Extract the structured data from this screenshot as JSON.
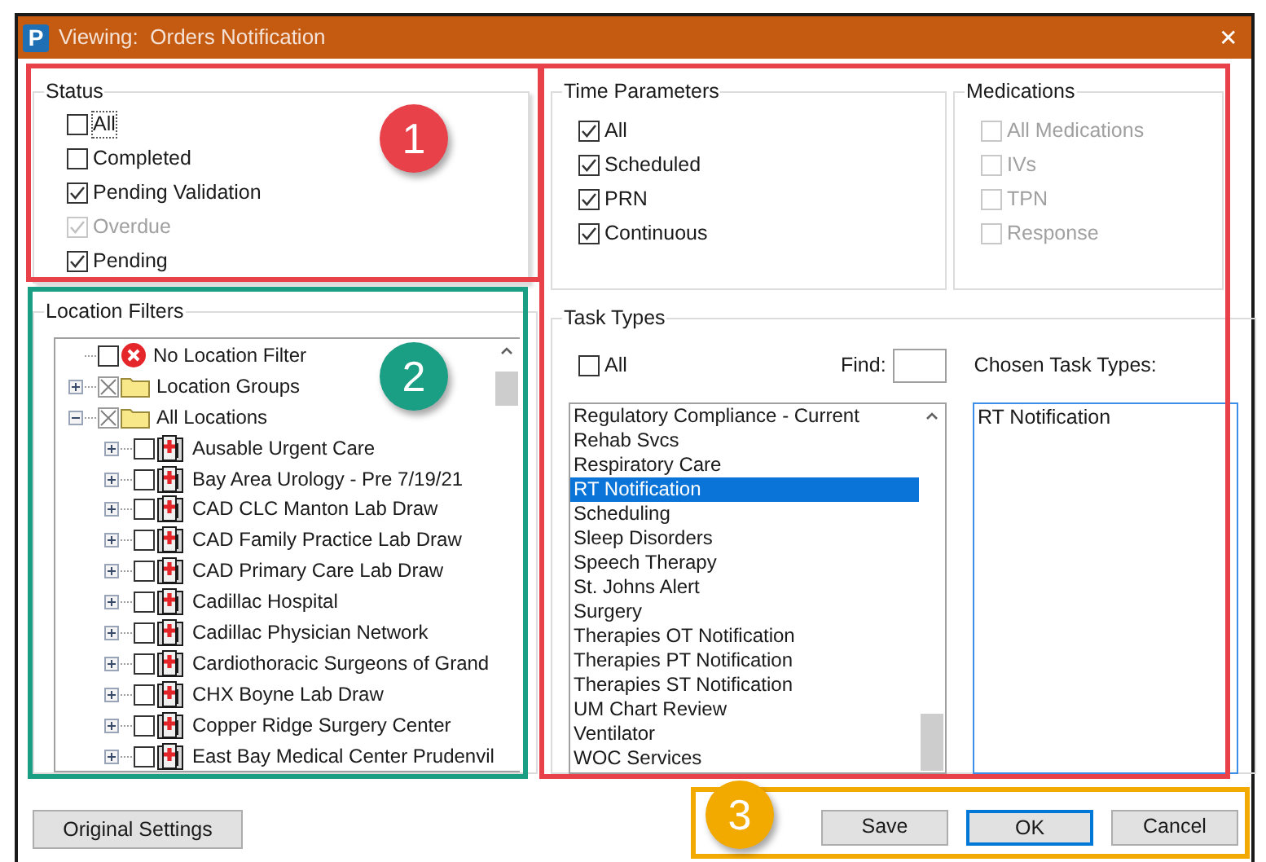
{
  "window": {
    "app_icon": "P",
    "title": "Viewing:  Orders Notification",
    "close": "✕"
  },
  "status": {
    "title": "Status",
    "items": [
      {
        "label": "All",
        "checked": false,
        "disabled": false,
        "focused": true
      },
      {
        "label": "Completed",
        "checked": false,
        "disabled": false,
        "focused": false
      },
      {
        "label": "Pending Validation",
        "checked": true,
        "disabled": false,
        "focused": false
      },
      {
        "label": "Overdue",
        "checked": true,
        "disabled": true,
        "focused": false
      },
      {
        "label": "Pending",
        "checked": true,
        "disabled": false,
        "focused": false
      }
    ]
  },
  "location_filters": {
    "title": "Location Filters",
    "tree": [
      {
        "label": "No Location Filter",
        "kind": "none",
        "checked": false,
        "mixed": false,
        "expandable": false
      },
      {
        "label": "Location Groups",
        "kind": "folder",
        "mixed": true,
        "expandable": true,
        "expanded": false
      },
      {
        "label": "All Locations",
        "kind": "folder",
        "mixed": true,
        "expandable": true,
        "expanded": true,
        "children": [
          {
            "label": "Ausable Urgent Care",
            "kind": "location",
            "checked": false,
            "mixed": false,
            "expandable": true,
            "expanded": false
          },
          {
            "label": "Bay Area Urology - Pre 7/19/21",
            "kind": "location",
            "checked": false,
            "mixed": false,
            "expandable": true,
            "expanded": false
          },
          {
            "label": "CAD CLC Manton Lab Draw",
            "kind": "location",
            "checked": false,
            "mixed": false,
            "expandable": true,
            "expanded": false
          },
          {
            "label": "CAD Family Practice Lab Draw",
            "kind": "location",
            "checked": false,
            "mixed": false,
            "expandable": true,
            "expanded": false
          },
          {
            "label": "CAD Primary Care Lab Draw",
            "kind": "location",
            "checked": false,
            "mixed": false,
            "expandable": true,
            "expanded": false
          },
          {
            "label": "Cadillac Hospital",
            "kind": "location",
            "checked": false,
            "mixed": false,
            "expandable": true,
            "expanded": false
          },
          {
            "label": "Cadillac Physician Network",
            "kind": "location",
            "checked": false,
            "mixed": false,
            "expandable": true,
            "expanded": false
          },
          {
            "label": "Cardiothoracic Surgeons of Grand",
            "kind": "location",
            "checked": false,
            "mixed": false,
            "expandable": true,
            "expanded": false
          },
          {
            "label": "CHX Boyne Lab Draw",
            "kind": "location",
            "checked": false,
            "mixed": false,
            "expandable": true,
            "expanded": false
          },
          {
            "label": "Copper Ridge Surgery Center",
            "kind": "location",
            "checked": false,
            "mixed": false,
            "expandable": true,
            "expanded": false
          },
          {
            "label": "East Bay Medical Center Prudenvil",
            "kind": "location",
            "checked": false,
            "mixed": false,
            "expandable": true,
            "expanded": false
          }
        ]
      }
    ]
  },
  "time_parameters": {
    "title": "Time Parameters",
    "items": [
      {
        "label": "All",
        "checked": true,
        "disabled": false
      },
      {
        "label": "Scheduled",
        "checked": true,
        "disabled": false
      },
      {
        "label": "PRN",
        "checked": true,
        "disabled": false
      },
      {
        "label": "Continuous",
        "checked": true,
        "disabled": false
      }
    ]
  },
  "medications": {
    "title": "Medications",
    "items": [
      {
        "label": "All Medications",
        "checked": false,
        "disabled": true
      },
      {
        "label": "IVs",
        "checked": false,
        "disabled": true
      },
      {
        "label": "TPN",
        "checked": false,
        "disabled": true
      },
      {
        "label": "Response",
        "checked": false,
        "disabled": true
      }
    ]
  },
  "task_types": {
    "title": "Task Types",
    "all": {
      "label": "All",
      "checked": false
    },
    "find_label": "Find:",
    "chosen_label": "Chosen Task Types:",
    "items": [
      {
        "label": "Regulatory Compliance - Current",
        "selected": false
      },
      {
        "label": "Rehab Svcs",
        "selected": false
      },
      {
        "label": "Respiratory Care",
        "selected": false
      },
      {
        "label": "RT Notification",
        "selected": true
      },
      {
        "label": "Scheduling",
        "selected": false
      },
      {
        "label": "Sleep Disorders",
        "selected": false
      },
      {
        "label": "Speech Therapy",
        "selected": false
      },
      {
        "label": "St. Johns Alert",
        "selected": false
      },
      {
        "label": "Surgery",
        "selected": false
      },
      {
        "label": "Therapies OT Notification",
        "selected": false
      },
      {
        "label": "Therapies PT Notification",
        "selected": false
      },
      {
        "label": "Therapies ST Notification",
        "selected": false
      },
      {
        "label": "UM Chart Review",
        "selected": false
      },
      {
        "label": "Ventilator",
        "selected": false
      },
      {
        "label": "WOC Services",
        "selected": false
      }
    ],
    "chosen": [
      "RT Notification"
    ]
  },
  "buttons": {
    "original_settings": "Original Settings",
    "actions": [
      {
        "label": "Save",
        "default": false
      },
      {
        "label": "OK",
        "default": true
      },
      {
        "label": "Cancel",
        "default": false
      }
    ]
  },
  "callouts": [
    {
      "label": "1",
      "color": "#e8414a"
    },
    {
      "label": "2",
      "color": "#1a9e84"
    },
    {
      "label": "3",
      "color": "#f2a900"
    }
  ]
}
